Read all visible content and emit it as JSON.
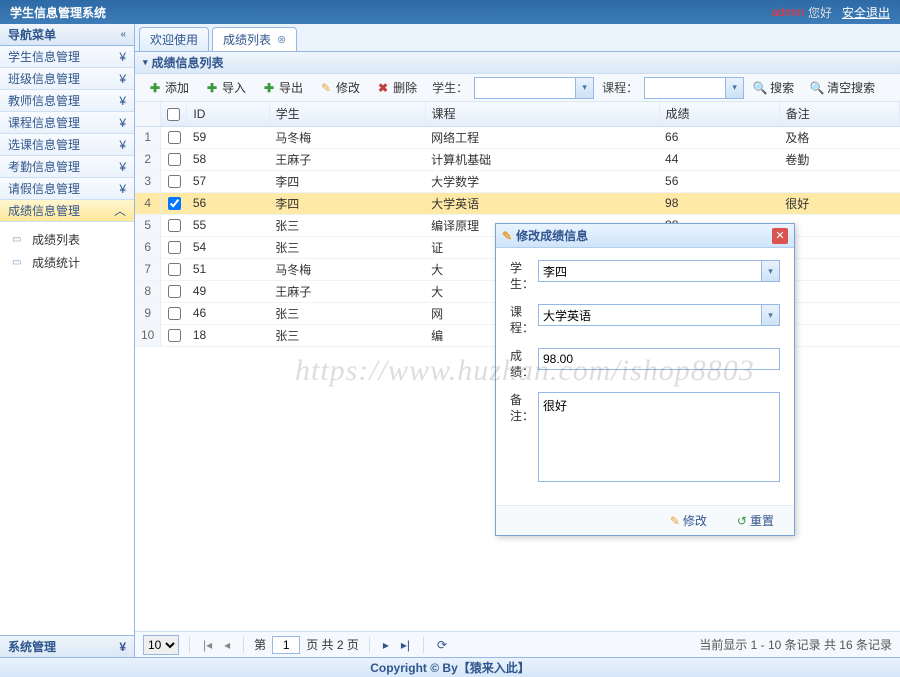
{
  "header": {
    "title": "学生信息管理系统",
    "user": "admin",
    "greet": "您好",
    "logout": "安全退出"
  },
  "sidebar": {
    "top_header": "导航菜单",
    "sections": [
      {
        "label": "学生信息管理"
      },
      {
        "label": "班级信息管理"
      },
      {
        "label": "教师信息管理"
      },
      {
        "label": "课程信息管理"
      },
      {
        "label": "选课信息管理"
      },
      {
        "label": "考勤信息管理"
      },
      {
        "label": "请假信息管理"
      },
      {
        "label": "成绩信息管理"
      }
    ],
    "tree": [
      {
        "label": "成绩列表"
      },
      {
        "label": "成绩统计"
      }
    ],
    "bottom_header": "系统管理"
  },
  "tabs": [
    {
      "label": "欢迎使用",
      "closable": false
    },
    {
      "label": "成绩列表",
      "closable": true,
      "active": true
    }
  ],
  "panel_title": "成绩信息列表",
  "toolbar": {
    "add": "添加",
    "import": "导入",
    "export": "导出",
    "edit": "修改",
    "delete": "删除",
    "label_student": "学生：",
    "label_course": "课程：",
    "search": "搜索",
    "clear": "清空搜索"
  },
  "grid": {
    "columns": [
      "ID",
      "学生",
      "课程",
      "成绩",
      "备注"
    ],
    "rows": [
      {
        "id": "59",
        "student": "马冬梅",
        "course": "网络工程",
        "score": "66",
        "remark": "及格"
      },
      {
        "id": "58",
        "student": "王麻子",
        "course": "计算机基础",
        "score": "44",
        "remark": "卷勤"
      },
      {
        "id": "57",
        "student": "李四",
        "course": "大学数学",
        "score": "56",
        "remark": ""
      },
      {
        "id": "56",
        "student": "李四",
        "course": "大学英语",
        "score": "98",
        "remark": "很好",
        "selected": true
      },
      {
        "id": "55",
        "student": "张三",
        "course": "编译原理",
        "score": "88",
        "remark": ""
      },
      {
        "id": "54",
        "student": "张三",
        "course": "证",
        "score": "",
        "remark": ""
      },
      {
        "id": "51",
        "student": "马冬梅",
        "course": "大",
        "score": "",
        "remark": ""
      },
      {
        "id": "49",
        "student": "王麻子",
        "course": "大",
        "score": "",
        "remark": ""
      },
      {
        "id": "46",
        "student": "张三",
        "course": "网",
        "score": "",
        "remark": ""
      },
      {
        "id": "18",
        "student": "张三",
        "course": "编",
        "score": "",
        "remark": ""
      }
    ]
  },
  "pager": {
    "page_size": "10",
    "page_label_pre": "第",
    "page_value": "1",
    "page_label_post": "页 共 2 页",
    "info": "当前显示 1 - 10 条记录 共 16 条记录"
  },
  "dialog": {
    "title": "修改成绩信息",
    "label_student": "学生：",
    "val_student": "李四",
    "label_course": "课程：",
    "val_course": "大学英语",
    "label_score": "成绩：",
    "val_score": "98.00",
    "label_remark": "备注：",
    "val_remark": "很好",
    "btn_submit": "修改",
    "btn_reset": "重置"
  },
  "footer": "Copyright © By【猿来入此】",
  "watermark": "https://www.huzhan.com/ishop8803"
}
